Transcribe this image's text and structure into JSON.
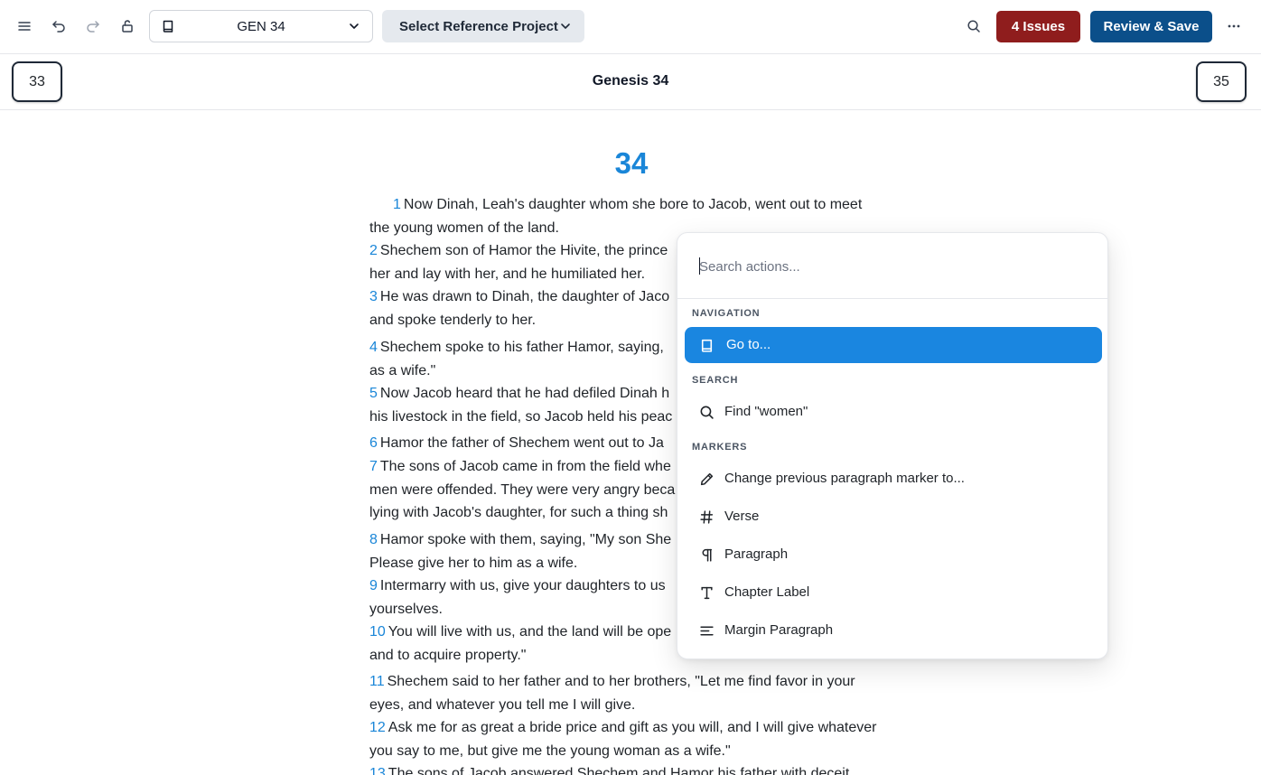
{
  "toolbar": {
    "book_reference": "GEN 34",
    "reference_project_label": "Select Reference Project",
    "issues_label": "4 Issues",
    "save_label": "Review & Save",
    "colors": {
      "issues": "#8f1d1d",
      "save": "#0b4f8a"
    }
  },
  "chapter_nav": {
    "prev": "33",
    "title": "Genesis 34",
    "next": "35"
  },
  "content": {
    "chapter_number": "34",
    "verses": [
      {
        "num": "1",
        "text": "Now Dinah, Leah's daughter whom she bore to Jacob, went out to meet",
        "cont": "the young women of the land."
      },
      {
        "num": "2",
        "text": "Shechem son of Hamor the Hivite, the prince",
        "cont": "her and lay with her, and he humiliated her."
      },
      {
        "num": "3",
        "text": "He was drawn to Dinah, the daughter of Jaco",
        "cont": "and spoke tenderly to her."
      },
      {
        "num": "4",
        "text": "Shechem spoke to his father Hamor, saying,",
        "cont": "as a wife.\""
      },
      {
        "num": "5",
        "text": "Now Jacob heard that he had defiled Dinah h",
        "cont": "his livestock in the field, so Jacob held his peac"
      },
      {
        "num": "6",
        "text": "Hamor the father of Shechem went out to Ja",
        "cont": ""
      },
      {
        "num": "7",
        "text": "The sons of Jacob came in from the field whe",
        "cont": "men were offended. They were very angry beca",
        "cont2": "lying with Jacob's daughter, for such a thing sh"
      },
      {
        "num": "8",
        "text": "Hamor spoke with them, saying, \"My son She",
        "cont": "Please give her to him as a wife."
      },
      {
        "num": "9",
        "text": "Intermarry with us, give your daughters to us",
        "cont": "yourselves."
      },
      {
        "num": "10",
        "text": "You will live with us, and the land will be ope",
        "cont": "and to acquire property.\""
      },
      {
        "num": "11",
        "text": "Shechem said to her father and to her brothers, \"Let me find favor in your",
        "cont": "eyes, and whatever you tell me I will give."
      },
      {
        "num": "12",
        "text": "Ask me for as great a bride price and gift as you will, and I will give whatever",
        "cont": "you say to me, but give me the young woman as a wife.\""
      },
      {
        "num": "13",
        "text": "The sons of Jacob answered Shechem and Hamor his father with deceit",
        "cont": ""
      }
    ]
  },
  "palette": {
    "search_placeholder": "Search actions...",
    "groups": {
      "navigation": "NAVIGATION",
      "search": "SEARCH",
      "markers": "MARKERS"
    },
    "items": {
      "goto": "Go to...",
      "find": "Find \"women\"",
      "change_marker": "Change previous paragraph marker to...",
      "verse": "Verse",
      "paragraph": "Paragraph",
      "chapter_label": "Chapter Label",
      "margin_paragraph": "Margin Paragraph"
    },
    "icons": [
      "book-icon",
      "search-icon",
      "pencil-icon",
      "hash-icon",
      "pilcrow-icon",
      "type-icon",
      "align-left-icon"
    ],
    "active_color": "#1a86e0"
  }
}
